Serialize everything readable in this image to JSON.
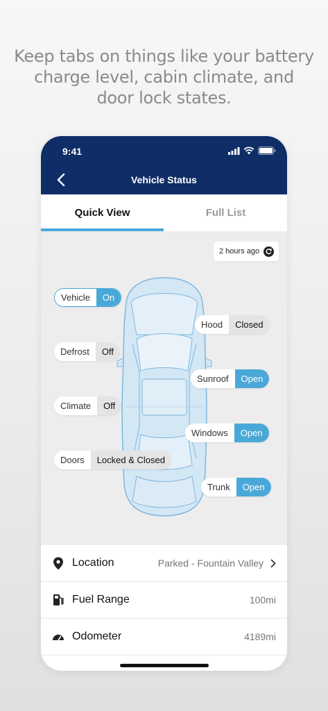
{
  "headline": "Keep tabs on things like your battery charge level, cabin climate, and door lock states.",
  "status_bar": {
    "time": "9:41"
  },
  "header": {
    "title": "Vehicle Status"
  },
  "tabs": [
    {
      "label": "Quick View",
      "active": true
    },
    {
      "label": "Full List",
      "active": false
    }
  ],
  "refresh": {
    "label": "2 hours ago"
  },
  "statuses": {
    "vehicle": {
      "label": "Vehicle",
      "value": "On"
    },
    "hood": {
      "label": "Hood",
      "value": "Closed"
    },
    "defrost": {
      "label": "Defrost",
      "value": "Off"
    },
    "sunroof": {
      "label": "Sunroof",
      "value": "Open"
    },
    "climate": {
      "label": "Climate",
      "value": "Off"
    },
    "windows": {
      "label": "Windows",
      "value": "Open"
    },
    "doors": {
      "label": "Doors",
      "value": "Locked & Closed"
    },
    "trunk": {
      "label": "Trunk",
      "value": "Open"
    }
  },
  "list": {
    "location": {
      "label": "Location",
      "value": "Parked - Fountain Valley",
      "icon": "location-pin-icon"
    },
    "fuel": {
      "label": "Fuel Range",
      "value": "100mi",
      "icon": "fuel-pump-icon"
    },
    "odometer": {
      "label": "Odometer",
      "value": "4189mi",
      "icon": "speedometer-icon"
    }
  },
  "colors": {
    "navy": "#0f2d66",
    "accent": "#4aa8d8",
    "car_fill": "#d3e7f5",
    "car_stroke": "#7fb6dd"
  }
}
